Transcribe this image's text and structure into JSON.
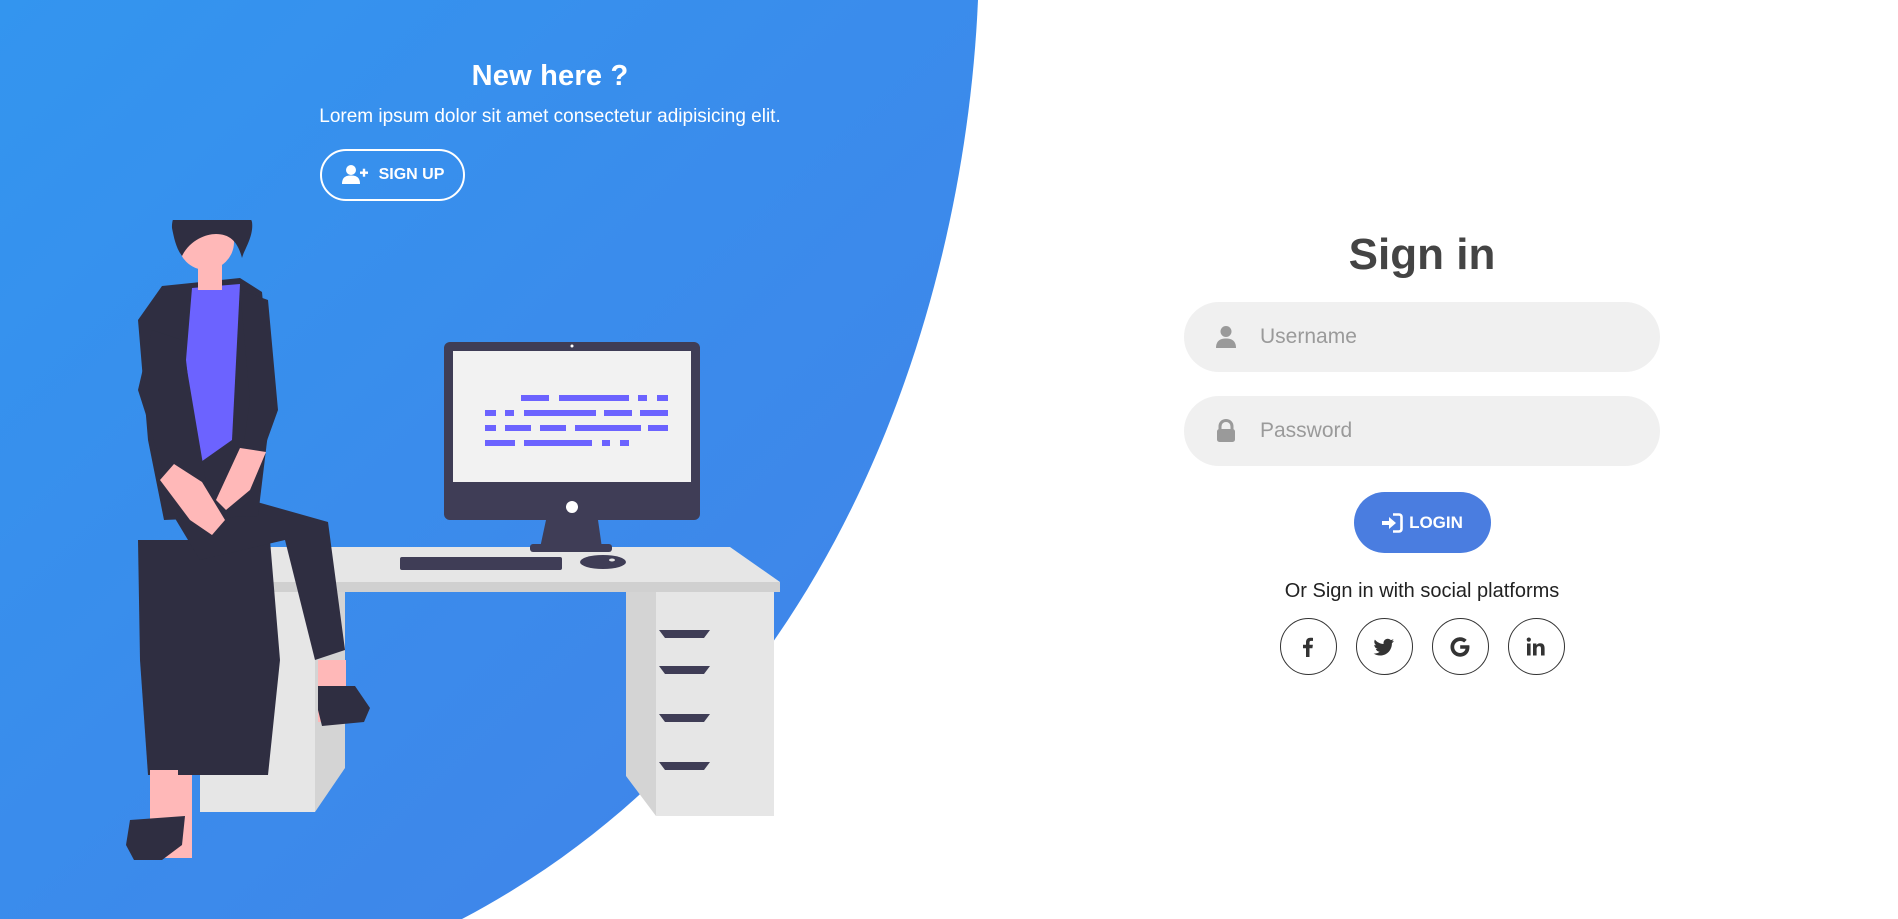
{
  "left_panel": {
    "heading": "New here ?",
    "description": "Lorem ipsum dolor sit amet consectetur adipisicing elit.",
    "signup_label": "SIGN UP",
    "signup_icon": "user-plus-icon",
    "illustration": "person-at-desk-illustration"
  },
  "signin": {
    "title": "Sign in",
    "username": {
      "placeholder": "Username",
      "value": "",
      "icon": "user-icon"
    },
    "password": {
      "placeholder": "Password",
      "value": "",
      "icon": "lock-icon"
    },
    "login_label": "LOGIN",
    "login_icon": "sign-in-icon",
    "social_text": "Or Sign in with social platforms",
    "social": [
      "facebook-icon",
      "twitter-icon",
      "google-icon",
      "linkedin-icon"
    ]
  },
  "colors": {
    "primary": "#4a7de0",
    "panel_gradient_start": "#3395ef",
    "panel_gradient_end": "#4284e8",
    "title": "#444444",
    "input_bg": "#f0f0f0"
  }
}
